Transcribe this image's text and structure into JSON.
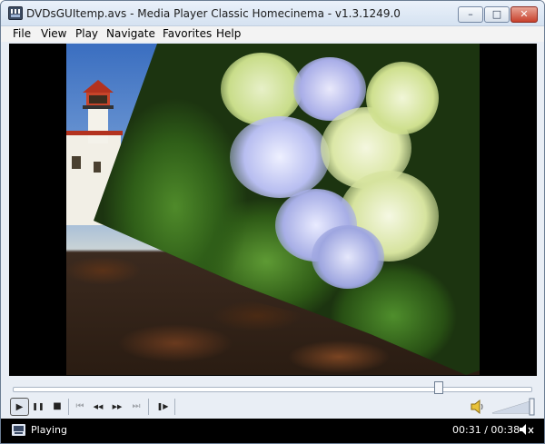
{
  "window": {
    "title": "DVDsGUItemp.avs - Media Player Classic Homecinema - v1.3.1249.0",
    "minimize_glyph": "–",
    "maximize_glyph": "□",
    "close_glyph": "✕"
  },
  "menu": {
    "items": [
      {
        "label": "File"
      },
      {
        "label": "View"
      },
      {
        "label": "Play"
      },
      {
        "label": "Navigate"
      },
      {
        "label": "Favorites"
      },
      {
        "label": "Help"
      }
    ]
  },
  "playback": {
    "seek_position": 0.82,
    "volume_level": 1.0
  },
  "controls": {
    "play_glyph": "▶",
    "pause_glyph": "❚❚",
    "stop_glyph": "■",
    "prev_glyph": "⏮",
    "rewind_glyph": "◀◀",
    "forward_glyph": "▶▶",
    "next_glyph": "⏭",
    "frame_step_glyph": "❚▶"
  },
  "status": {
    "state": "Playing",
    "time": "00:31 / 00:38"
  },
  "colors": {
    "window_bg": "#e9eef5",
    "video_bg": "#000000",
    "status_bg": "#000000",
    "close_red": "#c8412c"
  }
}
